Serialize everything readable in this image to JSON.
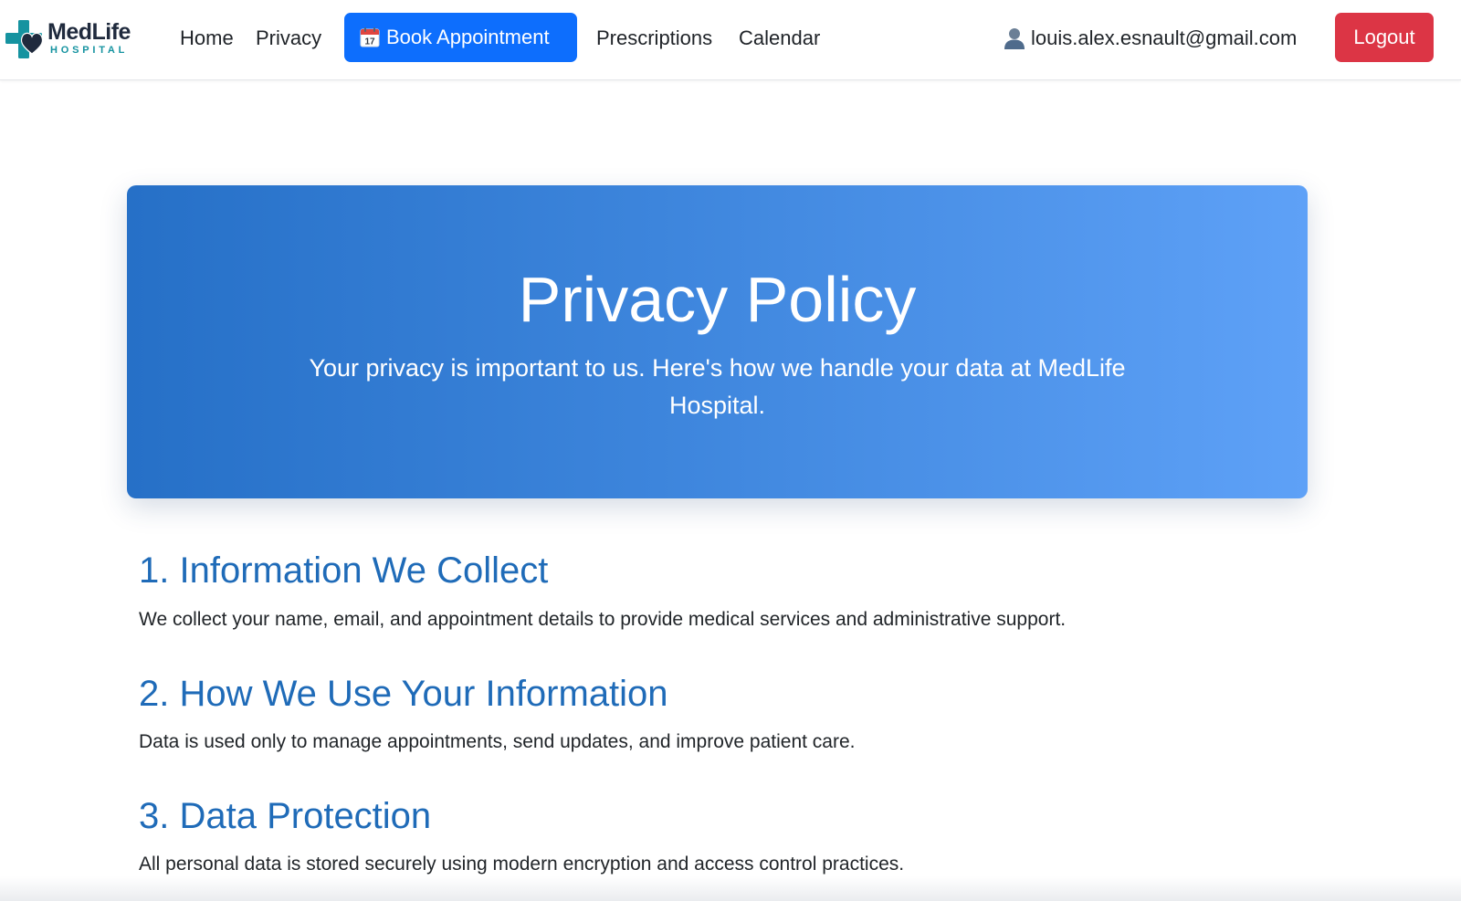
{
  "brand": {
    "name": "MedLife",
    "subtitle": "HOSPITAL",
    "colors": {
      "cross": "#1593a0",
      "heart": "#1f2a3d",
      "name": "#1f2a3d",
      "subtitle": "#1593a0"
    }
  },
  "nav": {
    "home": "Home",
    "privacy": "Privacy",
    "book_appointment": {
      "label": "Book Appointment",
      "icon": "calendar-icon",
      "color": "#0d6efd"
    },
    "prescriptions": "Prescriptions",
    "calendar": "Calendar"
  },
  "user": {
    "icon": "user-icon",
    "email": "louis.alex.esnault@gmail.com"
  },
  "logout": {
    "label": "Logout",
    "color": "#dc3545"
  },
  "hero": {
    "title": "Privacy Policy",
    "subtitle": "Your privacy is important to us. Here's how we handle your data at MedLife Hospital.",
    "gradient": [
      "#2670c7",
      "#5ea1f7"
    ]
  },
  "sections": [
    {
      "heading": "1. Information We Collect",
      "body": "We collect your name, email, and appointment details to provide medical services and administrative support."
    },
    {
      "heading": "2. How We Use Your Information",
      "body": "Data is used only to manage appointments, send updates, and improve patient care."
    },
    {
      "heading": "3. Data Protection",
      "body": "All personal data is stored securely using modern encryption and access control practices."
    }
  ],
  "colors": {
    "heading": "#1f6bb8",
    "text": "#212529"
  }
}
